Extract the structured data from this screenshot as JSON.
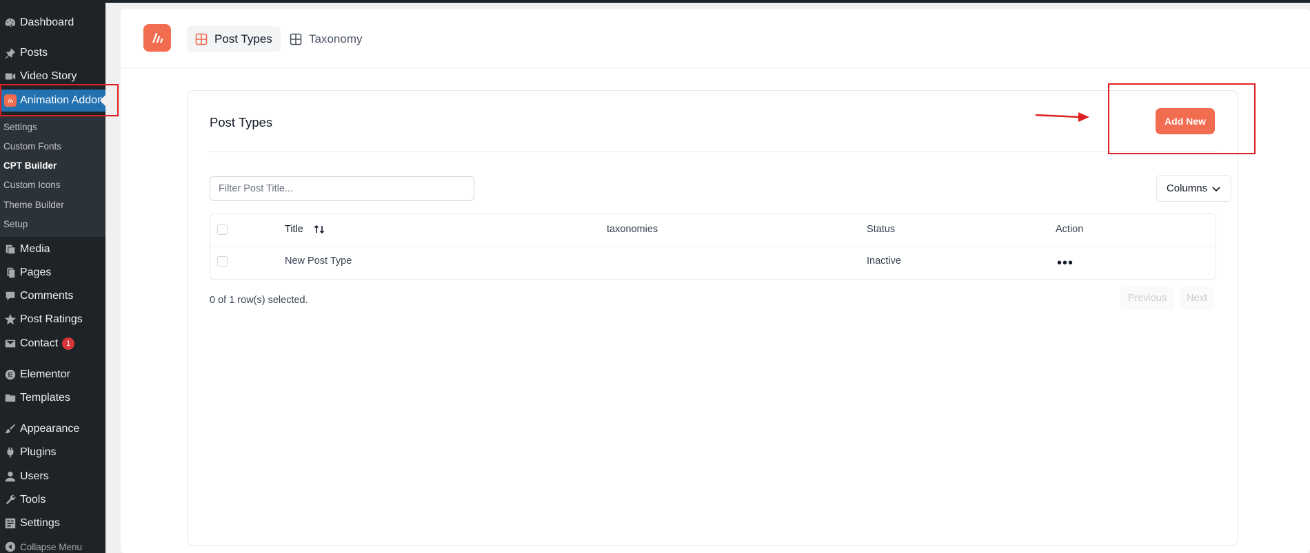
{
  "sidebar": {
    "items": [
      {
        "label": "Dashboard",
        "icon": "dashboard-icon"
      },
      {
        "label": "Posts",
        "icon": "pin-icon"
      },
      {
        "label": "Video Story",
        "icon": "video-icon"
      },
      {
        "label": "Animation Addon",
        "icon": "animation-addon-icon"
      },
      {
        "label": "Media",
        "icon": "media-icon"
      },
      {
        "label": "Pages",
        "icon": "pages-icon"
      },
      {
        "label": "Comments",
        "icon": "comment-icon"
      },
      {
        "label": "Post Ratings",
        "icon": "star-icon"
      },
      {
        "label": "Contact",
        "icon": "envelope-icon",
        "badge": "1"
      },
      {
        "label": "Elementor",
        "icon": "elementor-icon"
      },
      {
        "label": "Templates",
        "icon": "folder-icon"
      },
      {
        "label": "Appearance",
        "icon": "brush-icon"
      },
      {
        "label": "Plugins",
        "icon": "plug-icon"
      },
      {
        "label": "Users",
        "icon": "user-icon"
      },
      {
        "label": "Tools",
        "icon": "wrench-icon"
      },
      {
        "label": "Settings",
        "icon": "settings-icon"
      },
      {
        "label": "Collapse Menu",
        "icon": "collapse-icon"
      }
    ],
    "submenu": [
      "Settings",
      "Custom Fonts",
      "CPT Builder",
      "Custom Icons",
      "Theme Builder",
      "Setup"
    ],
    "current_submenu": "CPT Builder"
  },
  "header": {
    "tabs": [
      {
        "label": "Post Types",
        "active": true
      },
      {
        "label": "Taxonomy",
        "active": false
      }
    ]
  },
  "card": {
    "title": "Post Types",
    "add_button": "Add New"
  },
  "filter": {
    "placeholder": "Filter Post Title..."
  },
  "columns_button": "Columns",
  "table": {
    "headers": [
      "Title",
      "taxonomies",
      "Status",
      "Action"
    ],
    "rows": [
      {
        "title": "New Post Type",
        "taxonomies": "",
        "status": "Inactive",
        "action": "•••"
      }
    ]
  },
  "pagination": {
    "selected_text": "0 of 1 row(s) selected.",
    "previous": "Previous",
    "next": "Next"
  },
  "colors": {
    "accent": "#f26c4f",
    "wp_sidebar": "#1d2327",
    "wp_active": "#2271b1",
    "highlight": "#e02020"
  }
}
